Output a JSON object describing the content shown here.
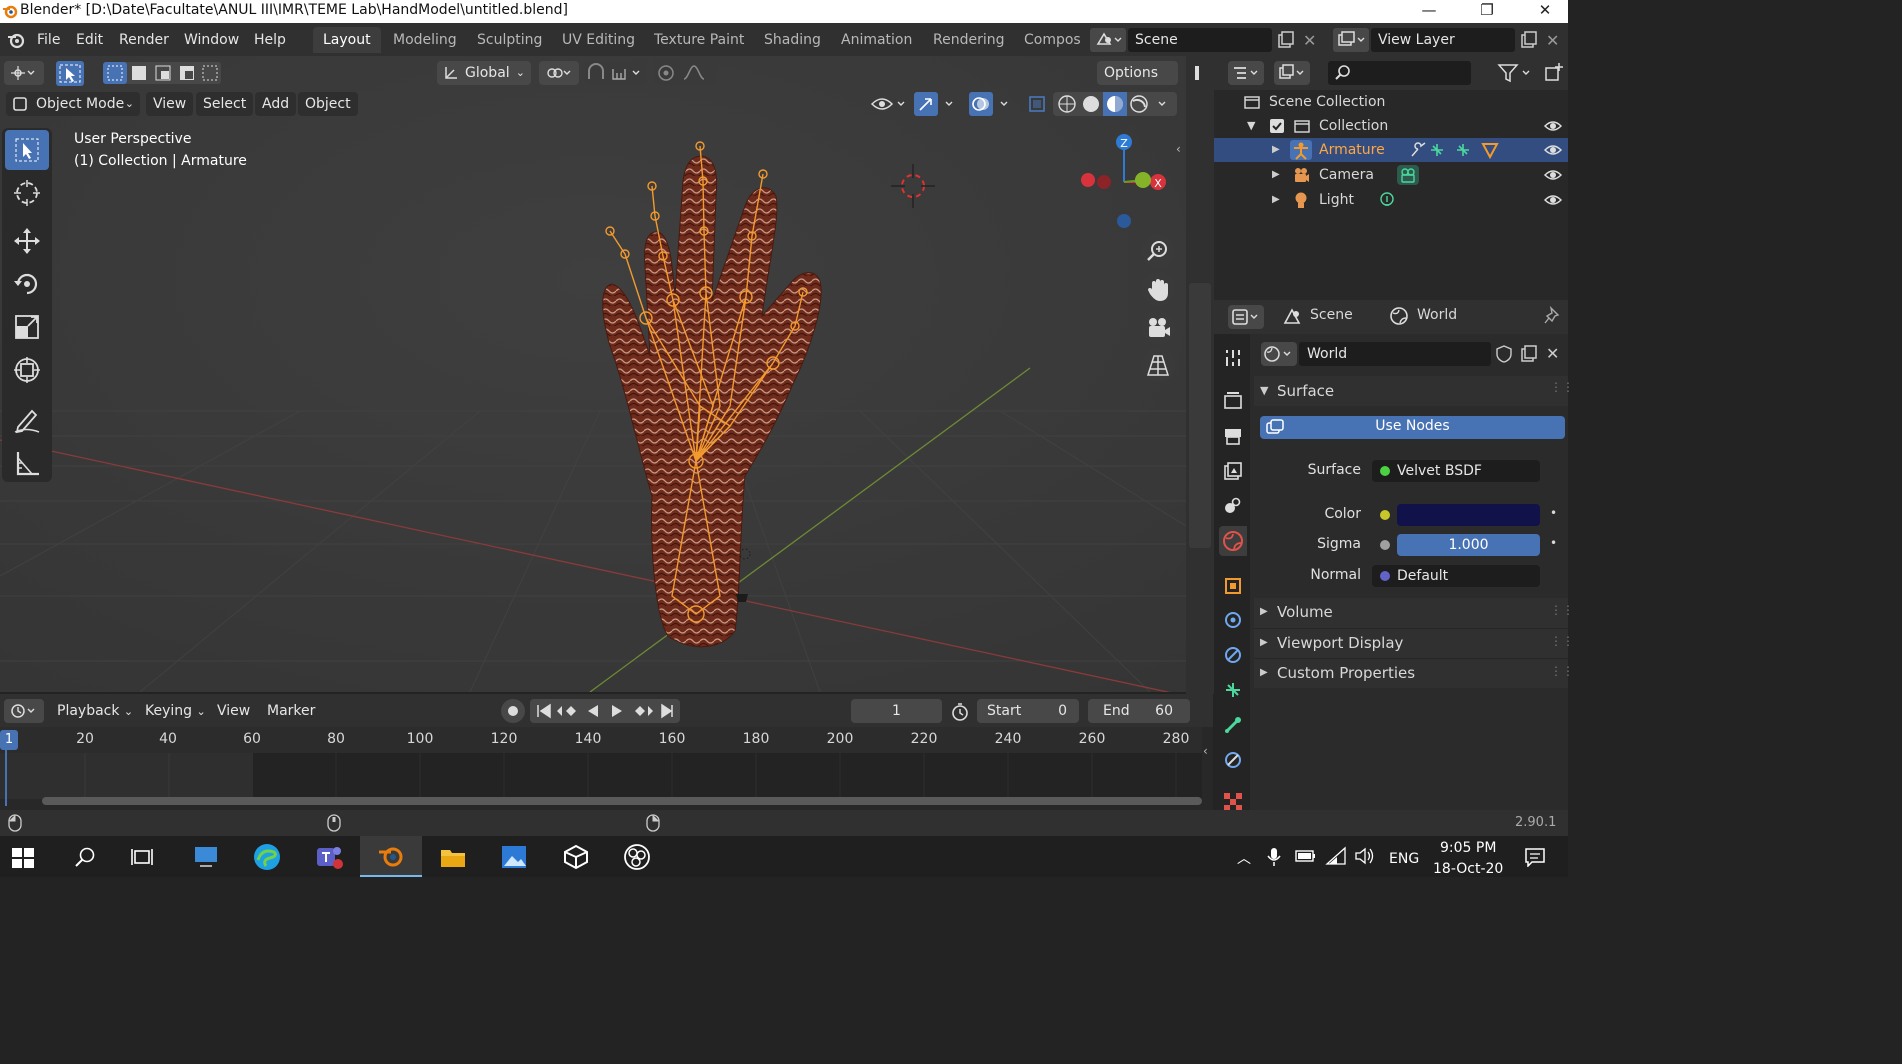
{
  "window": {
    "title": "Blender* [D:\\Date\\Facultate\\ANUL III\\IMR\\TEME Lab\\HandModel\\untitled.blend]",
    "minimize": "—",
    "maximize": "❐",
    "close": "✕"
  },
  "menubar": {
    "items": [
      "File",
      "Edit",
      "Render",
      "Window",
      "Help"
    ],
    "workspaces": [
      "Layout",
      "Modeling",
      "Sculpting",
      "UV Editing",
      "Texture Paint",
      "Shading",
      "Animation",
      "Rendering",
      "Compos"
    ],
    "active_workspace": "Layout",
    "scene": "Scene",
    "view_layer": "View Layer"
  },
  "toolheader": {
    "transform_orientation": "Global",
    "options": "Options"
  },
  "viewport": {
    "mode": "Object Mode",
    "menus": [
      "View",
      "Select",
      "Add",
      "Object"
    ],
    "overlay_line1": "User Perspective",
    "overlay_line2": "(1) Collection | Armature",
    "gizmo": {
      "z": "Z",
      "x": "X"
    }
  },
  "outliner": {
    "root": "Scene Collection",
    "collection": "Collection",
    "items": [
      {
        "name": "Armature",
        "selected": true
      },
      {
        "name": "Camera",
        "selected": false
      },
      {
        "name": "Light",
        "selected": false
      }
    ]
  },
  "properties": {
    "tab_scene": "Scene",
    "tab_world": "World",
    "world_name": "World",
    "sections": {
      "surface": "Surface",
      "volume": "Volume",
      "viewport_display": "Viewport Display",
      "custom_properties": "Custom Properties"
    },
    "use_nodes": "Use Nodes",
    "surface_label": "Surface",
    "surface_value": "Velvet BSDF",
    "color_label": "Color",
    "color_value": "#11124a",
    "sigma_label": "Sigma",
    "sigma_value": "1.000",
    "normal_label": "Normal",
    "normal_value": "Default",
    "accent": "#4772b3"
  },
  "timeline": {
    "menus": [
      "Playback",
      "Keying",
      "View",
      "Marker"
    ],
    "current_frame": "1",
    "start_label": "Start",
    "start_value": "0",
    "end_label": "End",
    "end_value": "60",
    "ruler": [
      "20",
      "40",
      "60",
      "80",
      "100",
      "120",
      "140",
      "160",
      "180",
      "200",
      "220",
      "240",
      "260",
      "280"
    ],
    "playhead": "1"
  },
  "status": {
    "version": "2.90.1"
  },
  "taskbar": {
    "language": "ENG",
    "time": "9:05 PM",
    "date": "18-Oct-20"
  }
}
